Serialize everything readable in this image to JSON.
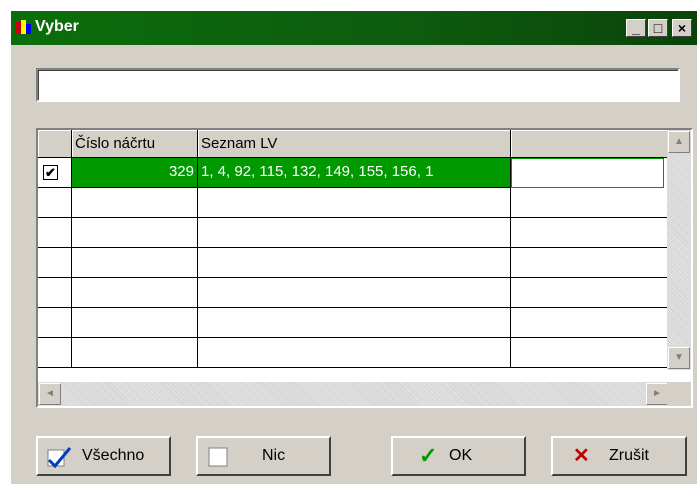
{
  "window": {
    "title": "Vyber",
    "minimize": "_",
    "maximize": "□",
    "close": "×"
  },
  "filter": {
    "value": ""
  },
  "grid": {
    "columns": [
      "Číslo náčrtu",
      "Seznam LV"
    ],
    "rows": [
      {
        "checked": true,
        "cislo": "329",
        "seznam": "1, 4, 92, 115, 132, 149, 155, 156, 1"
      }
    ]
  },
  "buttons": {
    "all": "Všechno",
    "none": "Nic",
    "ok": "OK",
    "cancel": "Zrušit"
  },
  "colors": {
    "selection": "#009900",
    "titlebar": "#0b6e0b"
  }
}
